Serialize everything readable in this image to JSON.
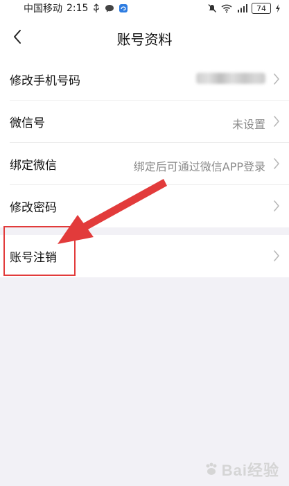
{
  "status_bar": {
    "carrier": "中国移动",
    "time": "2:15",
    "battery": "74"
  },
  "header": {
    "title": "账号资料"
  },
  "rows": [
    {
      "label": "修改手机号码",
      "value": ""
    },
    {
      "label": "微信号",
      "value": "未设置"
    },
    {
      "label": "绑定微信",
      "value": "绑定后可通过微信APP登录"
    },
    {
      "label": "修改密码",
      "value": ""
    },
    {
      "label": "账号注销",
      "value": ""
    }
  ],
  "watermark": {
    "text": "Bai经验"
  },
  "colors": {
    "background": "#f2f1f6",
    "annotation": "#e23b3b",
    "secondary_text": "#8a8a8a"
  }
}
